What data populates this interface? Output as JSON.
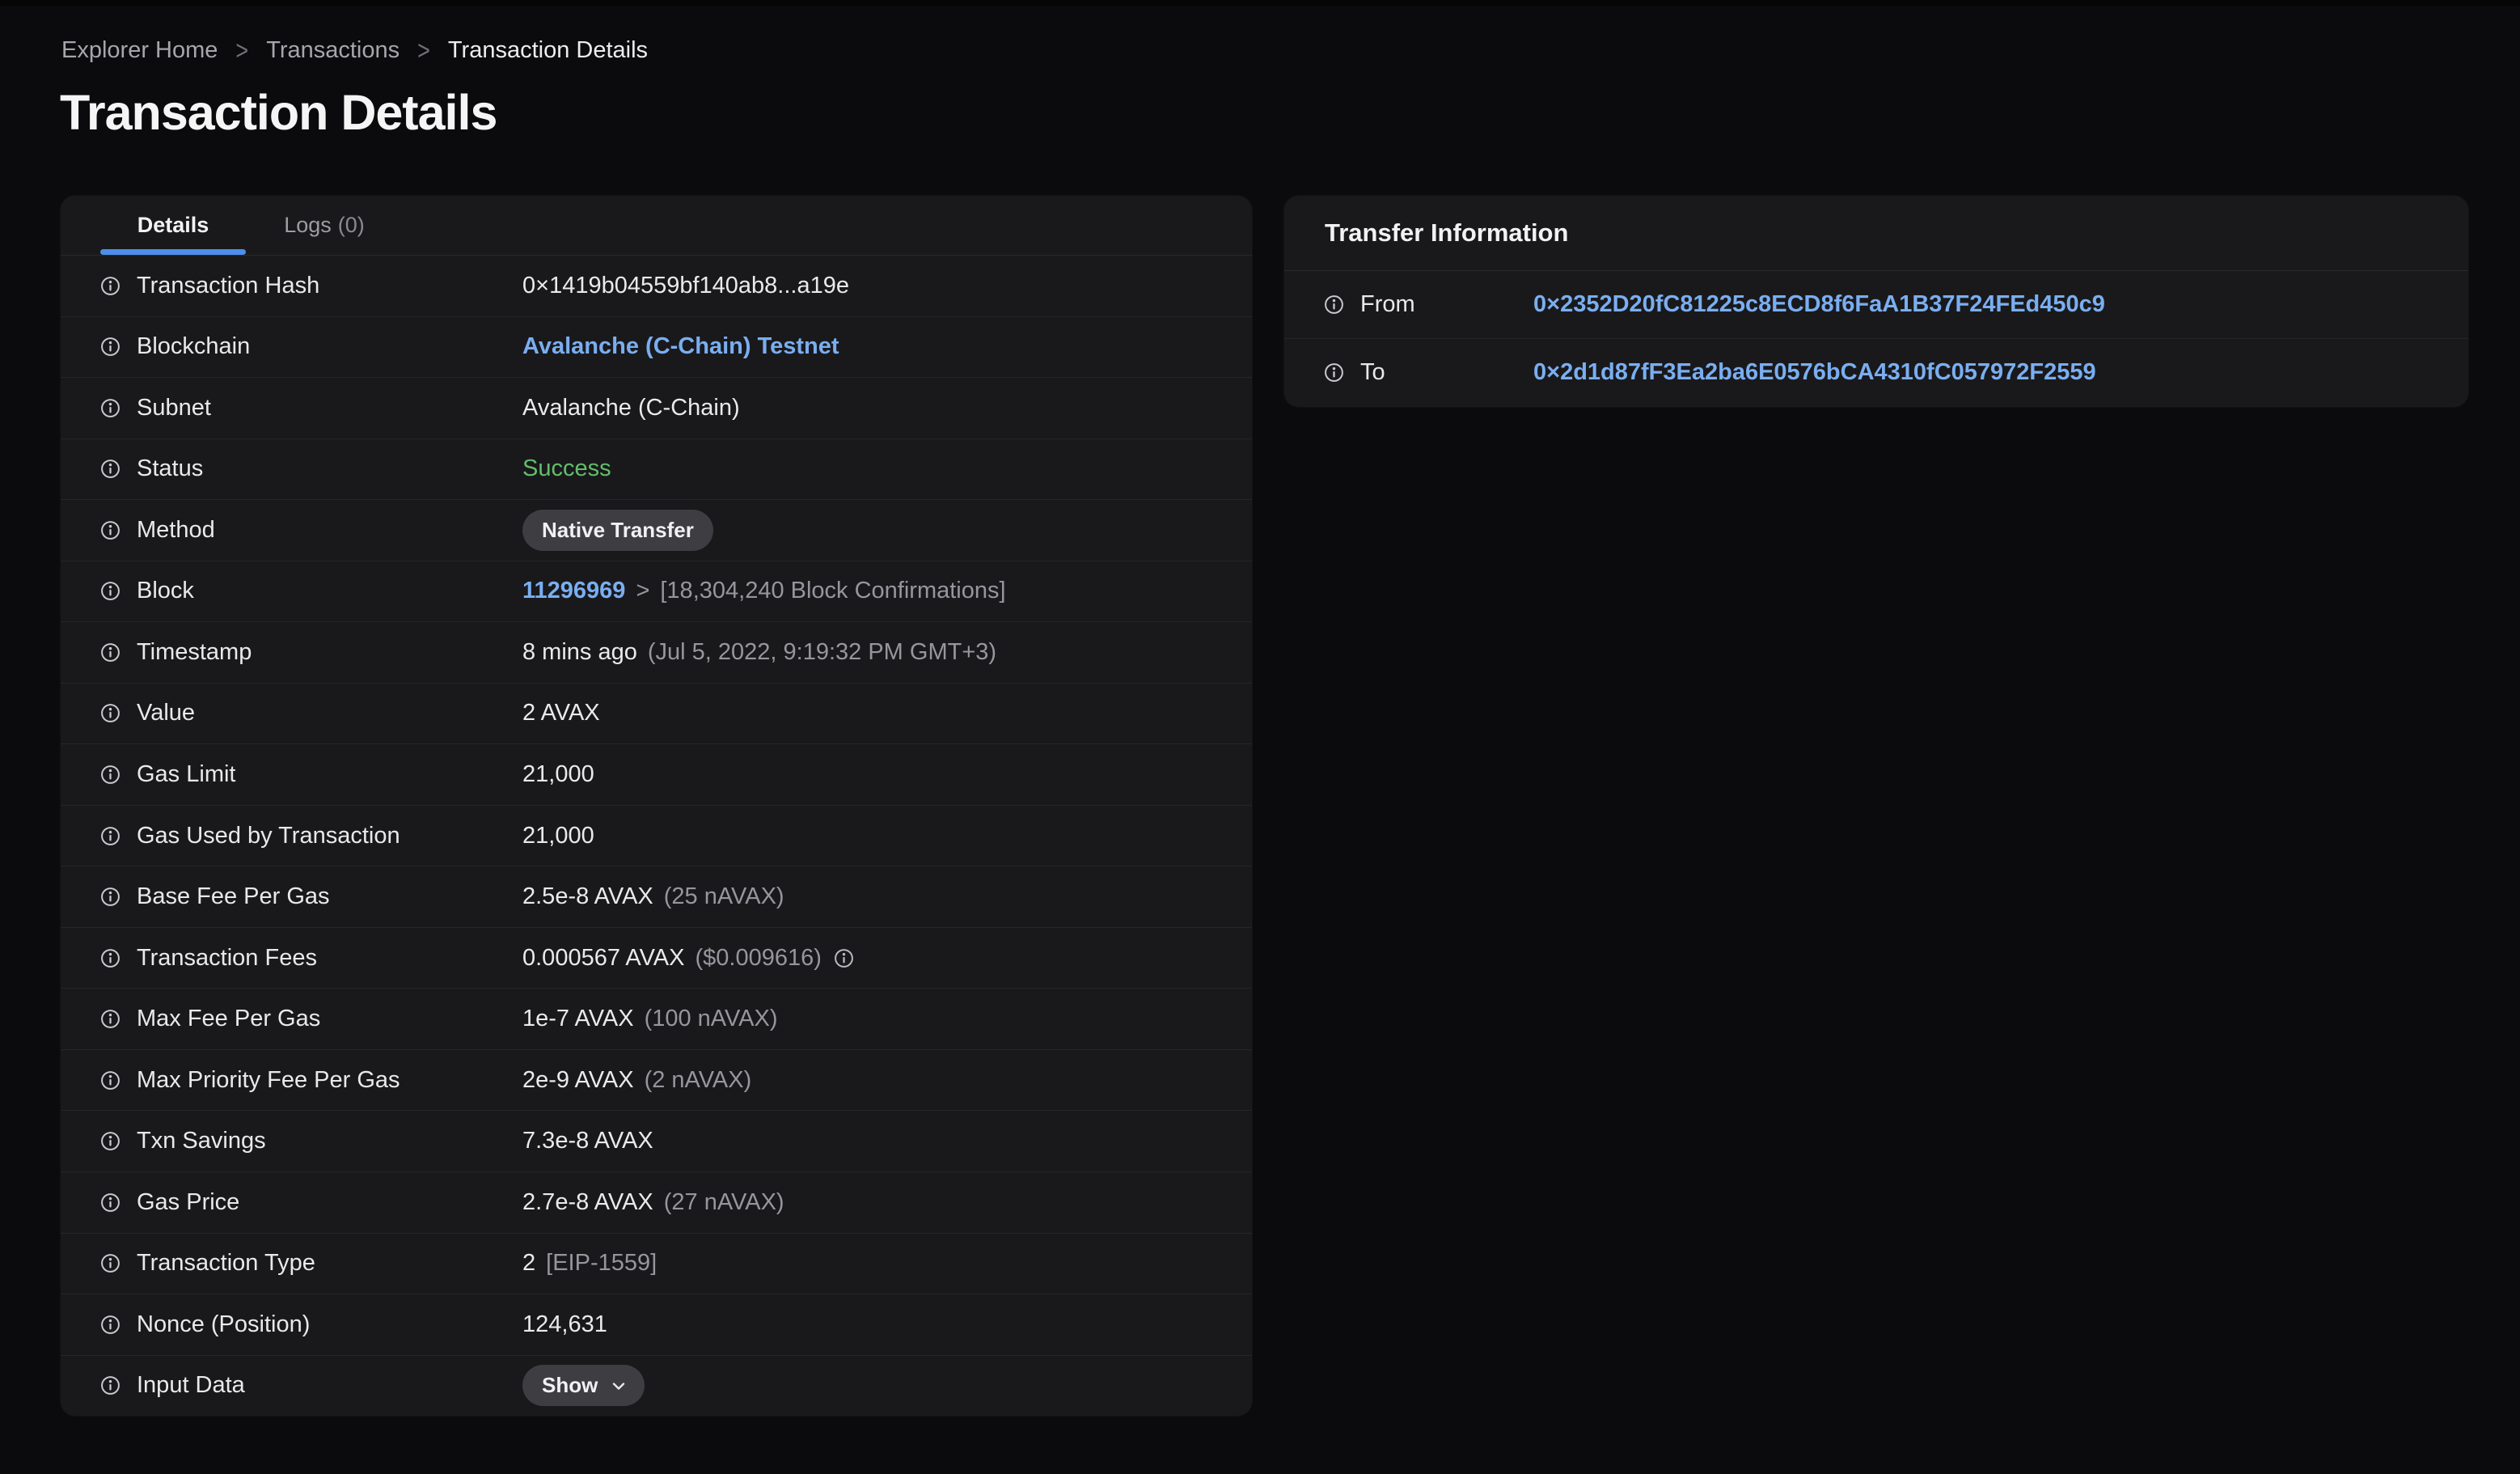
{
  "breadcrumb": {
    "separator": ">",
    "items": [
      {
        "label": "Explorer Home"
      },
      {
        "label": "Transactions"
      },
      {
        "label": "Transaction Details"
      }
    ]
  },
  "title": "Transaction Details",
  "colors": {
    "accent_blue": "#4c8eea",
    "link_blue": "#7aaef0",
    "success_green": "#64bd6b",
    "card_bg": "#19191c",
    "page_bg": "#0b0b0d"
  },
  "details_card": {
    "tabs": [
      {
        "label": "Details",
        "count": ""
      },
      {
        "label": "Logs",
        "count": "(0)"
      }
    ],
    "rows": [
      {
        "label": "Transaction Hash",
        "style": "text",
        "value": "0×1419b04559bf140ab8...a19e"
      },
      {
        "label": "Blockchain",
        "style": "link",
        "value": "Avalanche (C-Chain) Testnet"
      },
      {
        "label": "Subnet",
        "style": "text",
        "value": "Avalanche (C-Chain)"
      },
      {
        "label": "Status",
        "style": "status",
        "value": "Success"
      },
      {
        "label": "Method",
        "style": "badge",
        "value": "Native Transfer"
      },
      {
        "label": "Block",
        "style": "link",
        "value": "11296969",
        "sep": ">",
        "note": "[18,304,240 Block Confirmations]"
      },
      {
        "label": "Timestamp",
        "style": "text",
        "value": "8 mins ago",
        "note": "(Jul 5, 2022, 9:19:32 PM GMT+3)"
      },
      {
        "label": "Value",
        "style": "text",
        "value": "2 AVAX"
      },
      {
        "label": "Gas Limit",
        "style": "text",
        "value": "21,000"
      },
      {
        "label": "Gas Used by Transaction",
        "style": "text",
        "value": "21,000"
      },
      {
        "label": "Base Fee Per Gas",
        "style": "text",
        "value": "2.5e-8 AVAX",
        "note": "(25 nAVAX)"
      },
      {
        "label": "Transaction Fees",
        "style": "text",
        "value": "0.000567 AVAX",
        "note": "($0.009616)",
        "info_icon": true
      },
      {
        "label": "Max Fee Per Gas",
        "style": "text",
        "value": "1e-7 AVAX",
        "note": "(100 nAVAX)"
      },
      {
        "label": "Max Priority Fee Per Gas",
        "style": "text",
        "value": "2e-9 AVAX",
        "note": "(2 nAVAX)"
      },
      {
        "label": "Txn Savings",
        "style": "text",
        "value": "7.3e-8 AVAX"
      },
      {
        "label": "Gas Price",
        "style": "text",
        "value": "2.7e-8 AVAX",
        "note": "(27 nAVAX)"
      },
      {
        "label": "Transaction Type",
        "style": "text",
        "value": "2",
        "note": "[EIP-1559]"
      },
      {
        "label": "Nonce (Position)",
        "style": "text",
        "value": "124,631"
      },
      {
        "label": "Input Data",
        "style": "button",
        "value": "Show"
      }
    ]
  },
  "transfer_card": {
    "title": "Transfer Information",
    "rows": [
      {
        "label": "From",
        "style": "link",
        "value": "0×2352D20fC81225c8ECD8f6FaA1B37F24FEd450c9"
      },
      {
        "label": "To",
        "style": "link",
        "value": "0×2d1d87fF3Ea2ba6E0576bCA4310fC057972F2559"
      }
    ]
  }
}
